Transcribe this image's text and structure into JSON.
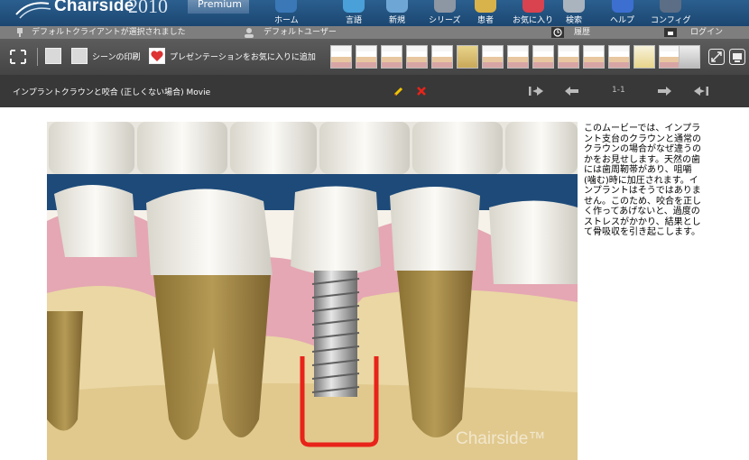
{
  "header": {
    "app_name": "Chairside",
    "app_year": "2010",
    "premium_label": "Premium",
    "nav": [
      {
        "label": "ホーム",
        "icon": "home-icon"
      },
      {
        "label": "言語",
        "icon": "language-icon"
      },
      {
        "label": "新規",
        "icon": "new-icon"
      },
      {
        "label": "シリーズ",
        "icon": "series-icon"
      },
      {
        "label": "患者",
        "icon": "patient-icon"
      },
      {
        "label": "お気に入り",
        "icon": "favorites-icon"
      },
      {
        "label": "検索",
        "icon": "search-icon"
      },
      {
        "label": "ヘルプ",
        "icon": "help-icon"
      },
      {
        "label": "コンフィグ",
        "icon": "config-icon"
      }
    ]
  },
  "status": {
    "client": "デフォルトクライアントが選択されました",
    "user": "デフォルトユーザー",
    "history": "履歴",
    "login": "ログイン"
  },
  "toolbar": {
    "print_scene": "シーンの印刷",
    "add_favorite": "プレゼンテーションをお気に入りに追加"
  },
  "titlebar": {
    "title": "インプラントクラウンと咬合 (正しくない場合) Movie",
    "page": "1-1"
  },
  "content": {
    "description": "このムービーでは、インプラント支台のクラウンと通常のクラウンの場合がなぜ違うのかをお見せします。天然の歯には歯周靭帯があり、咀嚼(噛む)時に加圧されます。インプラントはそうではありません。このため、咬合を正しく作ってあげないと、過度のストレスがかかり、結果として骨吸収を引き起こします。",
    "watermark": "Chairside™"
  },
  "colors": {
    "header_blue": "#1f4d79",
    "accent_red": "#e8231a",
    "gum_pink": "#e5a7b3",
    "bone_yellow": "#ead7a4"
  }
}
